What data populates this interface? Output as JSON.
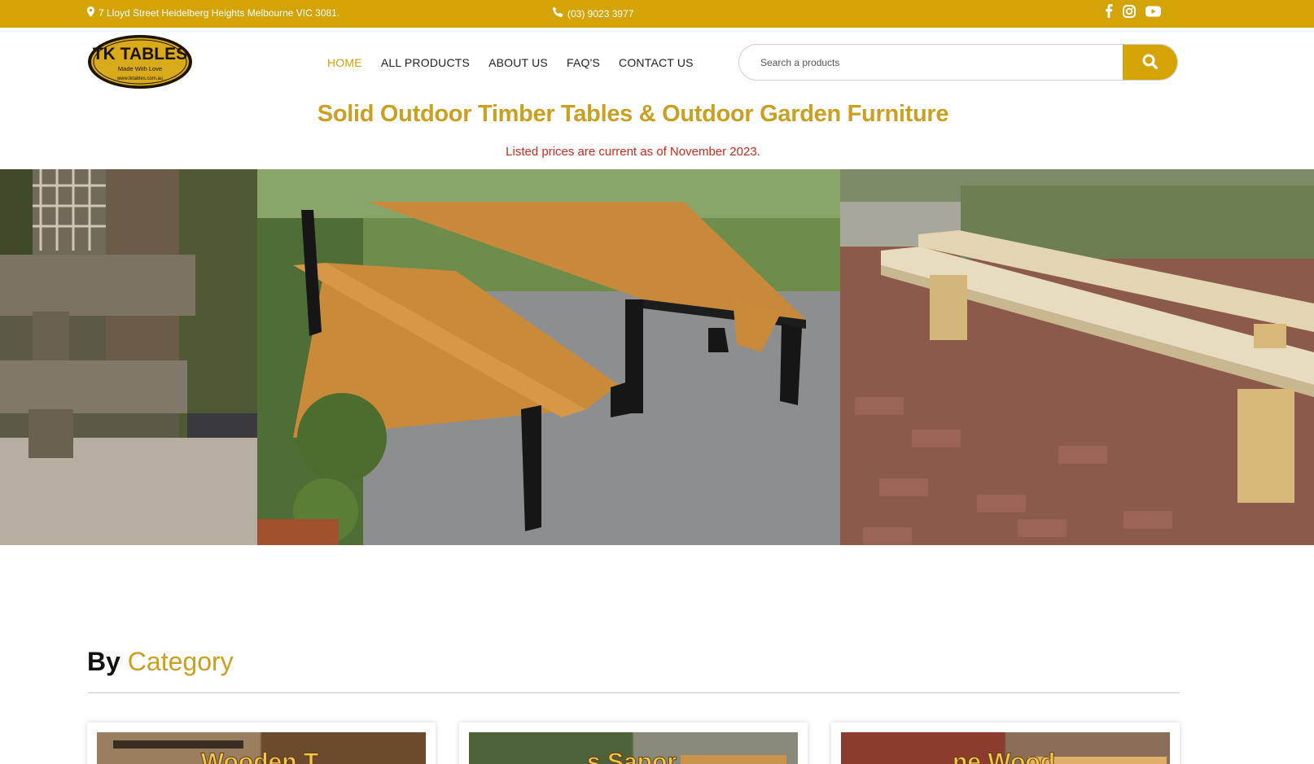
{
  "topbar": {
    "address": "7 Lloyd Street Heidelberg Heights Melbourne VIC 3081.",
    "phone": "(03) 9023 3977",
    "socials": [
      "facebook-icon",
      "instagram-icon",
      "youtube-icon"
    ]
  },
  "logo": {
    "line1": "TK TABLES",
    "line2": "Made With Love",
    "line3": "www.tktables.com.au"
  },
  "nav": {
    "items": [
      "HOME",
      "ALL PRODUCTS",
      "ABOUT US",
      "FAQ'S",
      "CONTACT US"
    ],
    "active_index": 0
  },
  "search": {
    "placeholder": "Search a products"
  },
  "hero": {
    "title": "Solid Outdoor Timber Tables & Outdoor Garden Furniture",
    "notice": "Listed prices are current as of November 2023."
  },
  "category": {
    "heading_prefix": "By",
    "heading_accent": "Category"
  },
  "colors": {
    "brand_gold": "#d4a305",
    "title_gold": "#c9a021",
    "notice_red": "#cc2a1e"
  }
}
